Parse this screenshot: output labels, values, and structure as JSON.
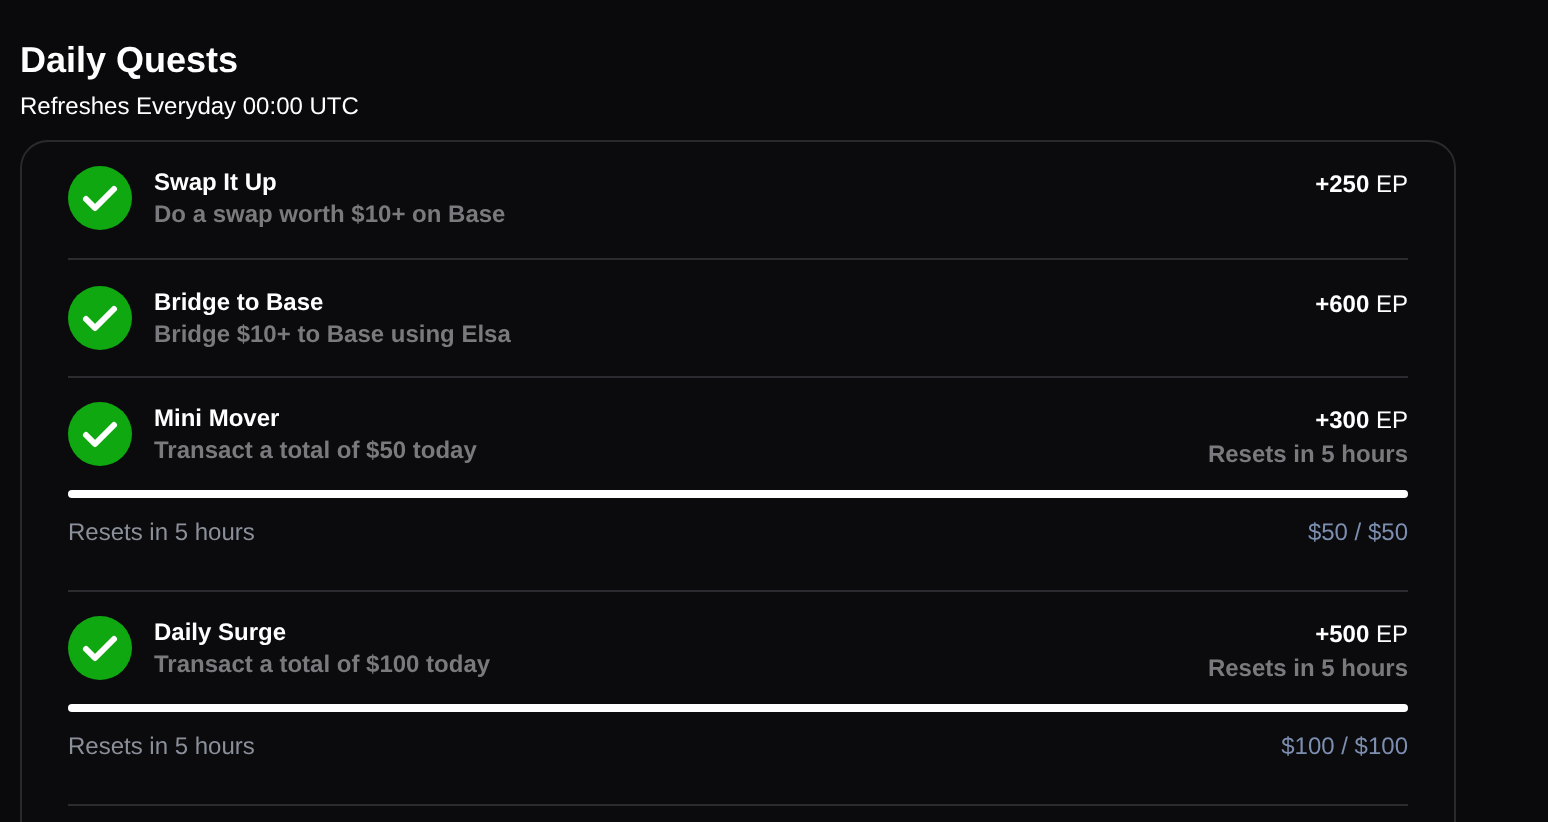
{
  "header": {
    "title": "Daily Quests",
    "subtitle": "Refreshes Everyday 00:00 UTC"
  },
  "quests": [
    {
      "kind": "simple",
      "title": "Swap It Up",
      "description": "Do a swap worth $10+ on Base",
      "reward": "**+250** EP",
      "completed": true
    },
    {
      "kind": "simple",
      "title": "Bridge to Base",
      "description": "Bridge $10+ to Base using Elsa",
      "reward": "**+600** EP",
      "completed": true
    },
    {
      "kind": "progress",
      "title": "Mini Mover",
      "description": "Transact a total of $50 today",
      "reward": "**+300** EP",
      "reset_note": "Resets in 5 hours",
      "completed": true,
      "level": 1,
      "footer_reset": "Resets in 5 hours",
      "progress_text": "$50 / $50"
    },
    {
      "kind": "progress",
      "title": "Daily Surge",
      "description": "Transact a total of $100 today",
      "reward": "**+500** EP",
      "reset_note": "Resets in 5 hours",
      "completed": true,
      "level": 1,
      "footer_reset": "Resets in 5 hours",
      "progress_text": "$100 / $100"
    }
  ]
}
